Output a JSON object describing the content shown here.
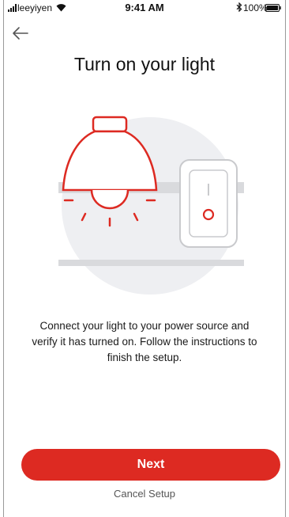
{
  "status_bar": {
    "carrier": "leeyiyen",
    "time": "9:41 AM",
    "battery": "100%"
  },
  "icons": {
    "back": "arrow-left-icon",
    "signal": "signal-bars-icon",
    "wifi": "wifi-icon",
    "bluetooth": "bluetooth-icon",
    "battery": "battery-icon"
  },
  "page": {
    "title": "Turn on your light",
    "description": "Connect your light to your power source and verify it has turned on. Follow the instructions to finish the setup."
  },
  "actions": {
    "next_label": "Next",
    "cancel_label": "Cancel Setup"
  },
  "colors": {
    "accent": "#dd2a22",
    "illustration_bg": "#eeeff2"
  }
}
